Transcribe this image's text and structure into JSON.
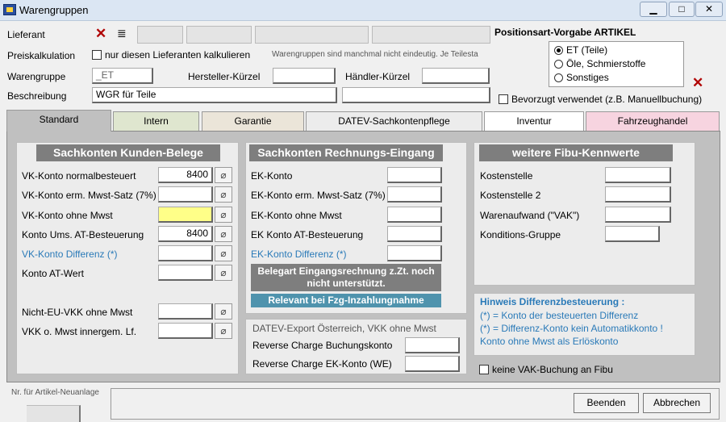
{
  "window": {
    "title": "Warengruppen",
    "minimize": "▁",
    "maximize": "□",
    "close": "✕"
  },
  "header": {
    "lieferant_label": "Lieferant",
    "preiskalkulation_label": "Preiskalkulation",
    "nur_lieferant_label": "nur diesen Lieferanten kalkulieren",
    "hint_text": "Warengruppen sind manchmal nicht eindeutig. Je Teilesta",
    "warengruppe_label": "Warengruppe",
    "warengruppe_value": "_ET",
    "hersteller_label": "Hersteller-Kürzel",
    "haendler_label": "Händler-Kürzel",
    "beschreibung_label": "Beschreibung",
    "beschreibung_value": "WGR für Teile",
    "positionsart_title": "Positionsart-Vorgabe ARTIKEL",
    "positionsart_options": [
      "ET (Teile)",
      "Öle, Schmierstoffe",
      "Sonstiges"
    ],
    "bevorzugt_label": "Bevorzugt verwendet (z.B. Manuellbuchung)"
  },
  "tabs": [
    "Standard",
    "Intern",
    "Garantie",
    "DATEV-Sachkontenpflege",
    "Inventur",
    "Fahrzeughandel"
  ],
  "kunden": {
    "title": "Sachkonten Kunden-Belege",
    "rows": [
      {
        "label": "VK-Konto normalbesteuert",
        "value": "8400"
      },
      {
        "label": "VK-Konto erm. Mwst-Satz (7%)",
        "value": ""
      },
      {
        "label": "VK-Konto ohne Mwst",
        "value": ""
      },
      {
        "label": "Konto Ums. AT-Besteuerung",
        "value": "8400"
      },
      {
        "label": "VK-Konto Differenz (*)",
        "value": ""
      },
      {
        "label": "Konto AT-Wert",
        "value": ""
      },
      {
        "label": "Nicht-EU-VKK ohne Mwst",
        "value": ""
      },
      {
        "label": "VKK o. Mwst innergem. Lf.",
        "value": ""
      }
    ]
  },
  "rechnung": {
    "title": "Sachkonten Rechnungs-Eingang",
    "rows": [
      {
        "label": "EK-Konto",
        "value": ""
      },
      {
        "label": "EK-Konto erm. Mwst-Satz (7%)",
        "value": ""
      },
      {
        "label": "EK-Konto ohne Mwst",
        "value": ""
      },
      {
        "label": "EK Konto AT-Besteuerung",
        "value": ""
      },
      {
        "label": "EK-Konto Differenz (*)",
        "value": ""
      }
    ],
    "belegart_note_1": "Belegart Eingangsrechnung z.Zt. noch",
    "belegart_note_2": "nicht unterstützt.",
    "relevant_note": "Relevant bei Fzg-Inzahlungnahme"
  },
  "datev": {
    "title": "DATEV-Export Österreich, VKK ohne Mwst",
    "rows": [
      {
        "label": "Reverse Charge Buchungskonto",
        "value": ""
      },
      {
        "label": "Reverse Charge EK-Konto (WE)",
        "value": ""
      }
    ]
  },
  "fibu": {
    "title": "weitere Fibu-Kennwerte",
    "rows": [
      {
        "label": "Kostenstelle",
        "value": ""
      },
      {
        "label": "Kostenstelle 2",
        "value": ""
      },
      {
        "label": "Warenaufwand (\"VAK\")",
        "value": ""
      },
      {
        "label": "Konditions-Gruppe",
        "value": ""
      }
    ]
  },
  "hinweis": {
    "title": "Hinweis Differenzbesteuerung :",
    "line1": "(*) = Konto der besteuerten Differenz",
    "line2": "(*) = Differenz-Konto kein Automatikkonto !",
    "line3": "Konto ohne Mwst als Erlöskonto"
  },
  "keine_vak_label": "keine VAK-Buchung an Fibu",
  "footer": {
    "nr_label": "Nr. für Artikel-Neuanlage",
    "beenden": "Beenden",
    "abbrechen": "Abbrechen"
  },
  "colors": {
    "highlight_field": "#ffff88",
    "tab_intern": "#dfe6cf",
    "tab_garantie": "#ebe5d9",
    "tab_fahrzeughandel": "#f7d4e0"
  }
}
